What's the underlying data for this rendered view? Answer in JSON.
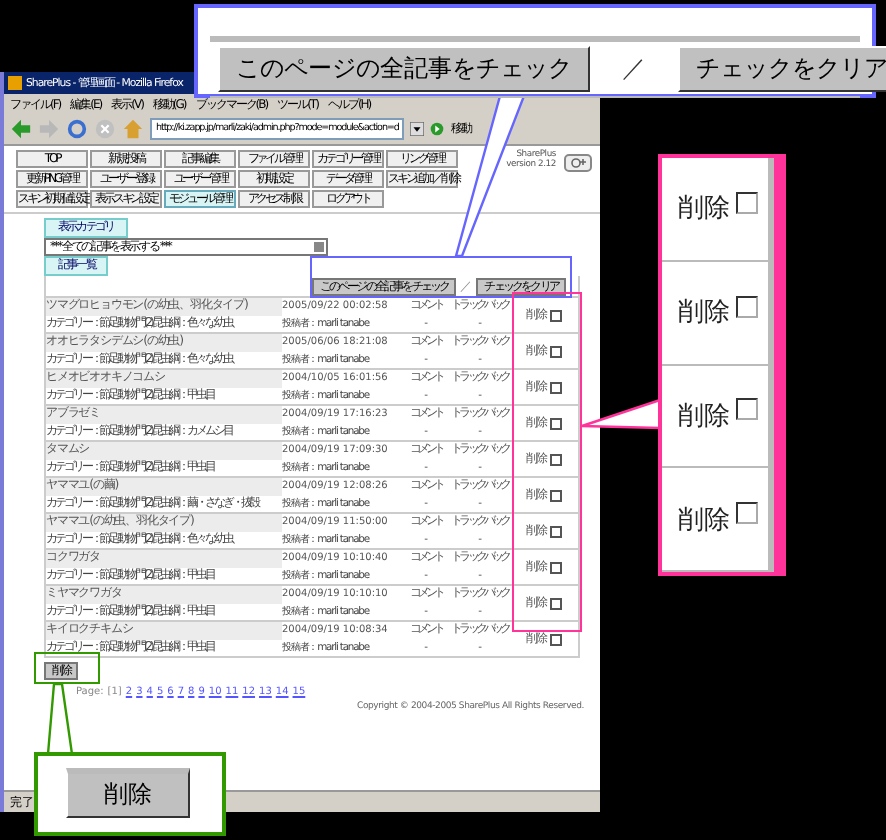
{
  "window": {
    "title": "SharePlus - 管理画面 - Mozilla Firefox",
    "menu": [
      "ファイル(F)",
      "編集(E)",
      "表示(V)",
      "移動(G)",
      "ブックマーク(B)",
      "ツール(T)",
      "ヘルプ(H)"
    ],
    "address": "http://ki.zapp.jp/marli/zaki/admin.php?mode=module&action=d",
    "go_button": "移動",
    "status": "完了"
  },
  "admin_nav": {
    "tabs": [
      {
        "label": "TOP",
        "selected": false
      },
      {
        "label": "新規投稿",
        "selected": false
      },
      {
        "label": "記事編集",
        "selected": false
      },
      {
        "label": "ファイル管理",
        "selected": false
      },
      {
        "label": "カテゴリー管理",
        "selected": false
      },
      {
        "label": "リンク管理",
        "selected": false
      },
      {
        "label": "更新PING管理",
        "selected": false
      },
      {
        "label": "ユーザー登録",
        "selected": false
      },
      {
        "label": "ユーザー管理",
        "selected": false
      },
      {
        "label": "初期設定",
        "selected": false
      },
      {
        "label": "データ管理",
        "selected": false
      },
      {
        "label": "スキン追加／削除",
        "selected": false
      },
      {
        "label": "スキン初期値設定",
        "selected": false
      },
      {
        "label": "表示スキン設定",
        "selected": false
      },
      {
        "label": "モジュール管理",
        "selected": true
      },
      {
        "label": "アクセス制限",
        "selected": false
      },
      {
        "label": "ログアウト",
        "selected": false
      }
    ],
    "app_name": "SharePlus",
    "version": "version 2.12"
  },
  "category_filter": {
    "tab": "表示カテゴリ",
    "value": "*** 全ての記事を表示する ***"
  },
  "article_list": {
    "tab": "記事一覧",
    "check_all_button": "このページの全記事をチェック",
    "separator": "／",
    "clear_button": "チェックをクリア",
    "delete_button": "削除",
    "rows": [
      {
        "title": "ツマグロヒョウモン(の幼虫、羽化タイプ)",
        "category": "カテゴリー：節足動物門(2)昆虫綱：色々な幼虫",
        "date": "2005/09/22 00:02:58",
        "author": "投稿者：marli tanabe",
        "comment_label": "コメント",
        "comment_count": "-",
        "trackback_label": "トラックバック",
        "trackback_count": "-",
        "delete_label": "削除",
        "checked": false
      },
      {
        "title": "オオヒラタシデムシ(の幼虫)",
        "category": "カテゴリー：節足動物門(2)昆虫綱：色々な幼虫",
        "date": "2005/06/06 18:21:08",
        "author": "投稿者：marli tanabe",
        "comment_label": "コメント",
        "comment_count": "-",
        "trackback_label": "トラックバック",
        "trackback_count": "-",
        "delete_label": "削除",
        "checked": false
      },
      {
        "title": "ヒメオビオオキノコムシ",
        "category": "カテゴリー：節足動物門(2)昆虫綱：甲虫目",
        "date": "2004/10/05 16:01:56",
        "author": "投稿者：marli tanabe",
        "comment_label": "コメント",
        "comment_count": "-",
        "trackback_label": "トラックバック",
        "trackback_count": "-",
        "delete_label": "削除",
        "checked": false
      },
      {
        "title": "アブラゼミ",
        "category": "カテゴリー：節足動物門(2)昆虫綱：カメムシ目",
        "date": "2004/09/19 17:16:23",
        "author": "投稿者：marli tanabe",
        "comment_label": "コメント",
        "comment_count": "-",
        "trackback_label": "トラックバック",
        "trackback_count": "-",
        "delete_label": "削除",
        "checked": false
      },
      {
        "title": "タマムシ",
        "category": "カテゴリー：節足動物門(2)昆虫綱：甲虫目",
        "date": "2004/09/19 17:09:30",
        "author": "投稿者：marli tanabe",
        "comment_label": "コメント",
        "comment_count": "-",
        "trackback_label": "トラックバック",
        "trackback_count": "-",
        "delete_label": "削除",
        "checked": false
      },
      {
        "title": "ヤママユ(の繭)",
        "category": "カテゴリー：節足動物門(2)昆虫綱：繭・さなぎ・抜殻",
        "date": "2004/09/19 12:08:26",
        "author": "投稿者：marli tanabe",
        "comment_label": "コメント",
        "comment_count": "-",
        "trackback_label": "トラックバック",
        "trackback_count": "-",
        "delete_label": "削除",
        "checked": false
      },
      {
        "title": "ヤママユ(の幼虫、羽化タイプ)",
        "category": "カテゴリー：節足動物門(2)昆虫綱：色々な幼虫",
        "date": "2004/09/19 11:50:00",
        "author": "投稿者：marli tanabe",
        "comment_label": "コメント",
        "comment_count": "-",
        "trackback_label": "トラックバック",
        "trackback_count": "-",
        "delete_label": "削除",
        "checked": false
      },
      {
        "title": "コクワガタ",
        "category": "カテゴリー：節足動物門(2)昆虫綱：甲虫目",
        "date": "2004/09/19 10:10:40",
        "author": "投稿者：marli tanabe",
        "comment_label": "コメント",
        "comment_count": "-",
        "trackback_label": "トラックバック",
        "trackback_count": "-",
        "delete_label": "削除",
        "checked": false
      },
      {
        "title": "ミヤマクワガタ",
        "category": "カテゴリー：節足動物門(2)昆虫綱：甲虫目",
        "date": "2004/09/19 10:10:10",
        "author": "投稿者：marli tanabe",
        "comment_label": "コメント",
        "comment_count": "-",
        "trackback_label": "トラックバック",
        "trackback_count": "-",
        "delete_label": "削除",
        "checked": false
      },
      {
        "title": "キイロクチキムシ",
        "category": "カテゴリー：節足動物門(2)昆虫綱：甲虫目",
        "date": "2004/09/19 10:08:34",
        "author": "投稿者：marli tanabe",
        "comment_label": "コメント",
        "comment_count": "-",
        "trackback_label": "トラックバック",
        "trackback_count": "-",
        "delete_label": "削除",
        "checked": false
      }
    ]
  },
  "pagination": {
    "label": "Page:",
    "pages": [
      {
        "label": "[1]",
        "selected": true
      },
      {
        "label": "2",
        "selected": false
      },
      {
        "label": "3",
        "selected": false
      },
      {
        "label": "4",
        "selected": false
      },
      {
        "label": "5",
        "selected": false
      },
      {
        "label": "6",
        "selected": false
      },
      {
        "label": "7",
        "selected": false
      },
      {
        "label": "8",
        "selected": false
      },
      {
        "label": "9",
        "selected": false
      },
      {
        "label": "10",
        "selected": false
      },
      {
        "label": "11",
        "selected": false
      },
      {
        "label": "12",
        "selected": false
      },
      {
        "label": "13",
        "selected": false
      },
      {
        "label": "14",
        "selected": false
      },
      {
        "label": "15",
        "selected": false
      }
    ]
  },
  "copyright": "Copyright © 2004-2005 SharePlus All Rights Reserved.",
  "callouts": {
    "top": {
      "check_all_button": "このページの全記事をチェック",
      "separator": "／",
      "clear_button": "チェックをクリア"
    },
    "right": {
      "rows": [
        {
          "label": "削除",
          "checked": false
        },
        {
          "label": "削除",
          "checked": false
        },
        {
          "label": "削除",
          "checked": false
        },
        {
          "label": "削除",
          "checked": false
        }
      ]
    },
    "bottom": {
      "delete_button": "削除"
    }
  }
}
